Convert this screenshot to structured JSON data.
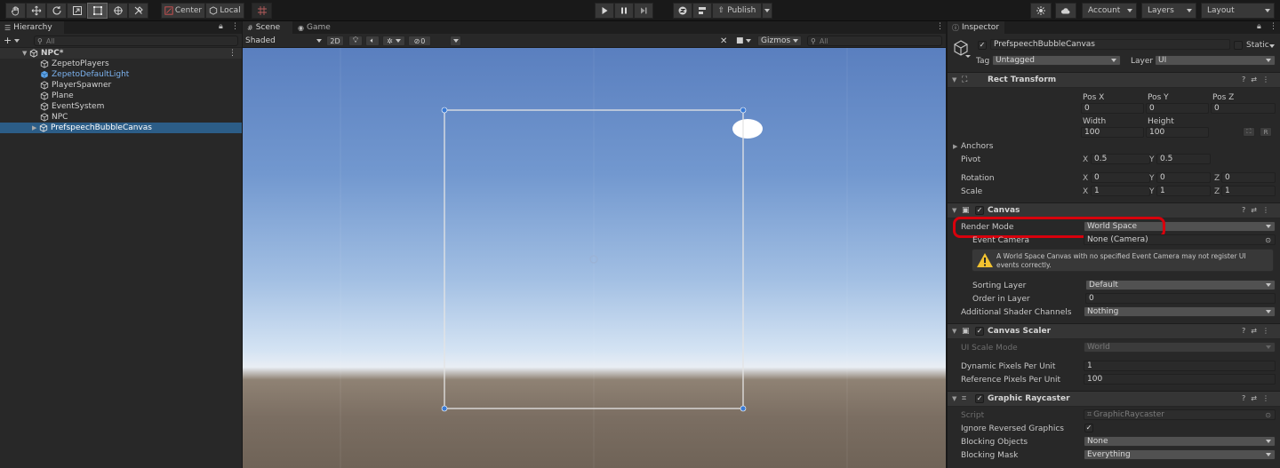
{
  "toolbar": {
    "pivot_label": "Center",
    "space_label": "Local",
    "publish_label": "Publish",
    "account_label": "Account",
    "layers_label": "Layers",
    "layout_label": "Layout"
  },
  "hierarchy": {
    "tab_label": "Hierarchy",
    "search_placeholder": "All",
    "add_label": "+",
    "scene_name": "NPC*",
    "items": [
      {
        "label": "ZepetoPlayers"
      },
      {
        "label": "ZepetoDefaultLight"
      },
      {
        "label": "PlayerSpawner"
      },
      {
        "label": "Plane"
      },
      {
        "label": "EventSystem"
      },
      {
        "label": "NPC"
      },
      {
        "label": "PrefspeechBubbleCanvas"
      }
    ]
  },
  "scene": {
    "tab_scene": "Scene",
    "tab_game": "Game",
    "shading_mode": "Shaded",
    "mode_2d": "2D",
    "effects_count": "0",
    "gizmos_label": "Gizmos",
    "search_placeholder": "All"
  },
  "inspector": {
    "tab_label": "Inspector",
    "object_name": "PrefspeechBubbleCanvas",
    "static_label": "Static",
    "tag_label": "Tag",
    "tag_value": "Untagged",
    "layer_label": "Layer",
    "layer_value": "UI",
    "rect_transform": {
      "title": "Rect Transform",
      "pos_x_label": "Pos X",
      "pos_y_label": "Pos Y",
      "pos_z_label": "Pos Z",
      "pos_x": "0",
      "pos_y": "0",
      "pos_z": "0",
      "width_label": "Width",
      "height_label": "Height",
      "width": "100",
      "height": "100",
      "r_button": "R",
      "anchors_label": "Anchors",
      "pivot_label": "Pivot",
      "pivot_x": "0.5",
      "pivot_y": "0.5",
      "rotation_label": "Rotation",
      "rot_x": "0",
      "rot_y": "0",
      "rot_z": "0",
      "scale_label": "Scale",
      "scale_x": "1",
      "scale_y": "1",
      "scale_z": "1",
      "x_axis": "X",
      "y_axis": "Y",
      "z_axis": "Z"
    },
    "canvas": {
      "title": "Canvas",
      "render_mode_label": "Render Mode",
      "render_mode_value": "World Space",
      "event_camera_label": "Event Camera",
      "event_camera_value": "None (Camera)",
      "warning_text": "A World Space Canvas with no specified Event Camera may not register UI events correctly.",
      "sorting_layer_label": "Sorting Layer",
      "sorting_layer_value": "Default",
      "order_in_layer_label": "Order in Layer",
      "order_in_layer_value": "0",
      "shader_channels_label": "Additional Shader Channels",
      "shader_channels_value": "Nothing"
    },
    "canvas_scaler": {
      "title": "Canvas Scaler",
      "ui_scale_mode_label": "UI Scale Mode",
      "ui_scale_mode_value": "World",
      "dynamic_ppu_label": "Dynamic Pixels Per Unit",
      "dynamic_ppu_value": "1",
      "reference_ppu_label": "Reference Pixels Per Unit",
      "reference_ppu_value": "100"
    },
    "graphic_raycaster": {
      "title": "Graphic Raycaster",
      "script_label": "Script",
      "script_value": "GraphicRaycaster",
      "ignore_reversed_label": "Ignore Reversed Graphics",
      "blocking_objects_label": "Blocking Objects",
      "blocking_objects_value": "None",
      "blocking_mask_label": "Blocking Mask",
      "blocking_mask_value": "Everything"
    }
  },
  "colors": {
    "selection": "#2c5d87",
    "highlight_ring": "#d8000c",
    "warning_icon": "#f2c230",
    "prefab_blue": "#7cb3f0"
  }
}
